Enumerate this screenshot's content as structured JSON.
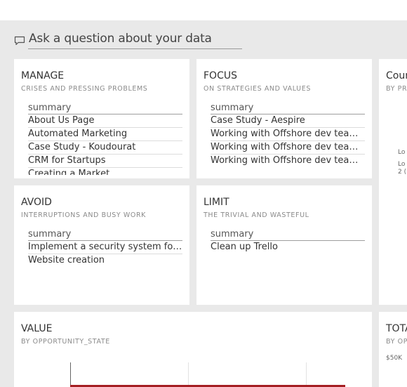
{
  "qa": {
    "placeholder": "Ask a question about your data"
  },
  "tiles": {
    "manage": {
      "title": "MANAGE",
      "subtitle": "CRISES AND PRESSING PROBLEMS",
      "header": "summary",
      "items": [
        "About Us Page",
        "Automated Marketing",
        "Case Study - Koudourat",
        "CRM for Startups"
      ],
      "cut_item": "Creating a Market"
    },
    "focus": {
      "title": "FOCUS",
      "subtitle": "ON STRATEGIES AND VALUES",
      "header": "summary",
      "items": [
        "Case Study - Aespire",
        "Working with Offshore dev teams ...",
        "Working with Offshore dev teams ...",
        "Working with Offshore dev teams ..."
      ]
    },
    "avoid": {
      "title": "AVOID",
      "subtitle": "INTERRUPTIONS AND BUSY WORK",
      "header": "summary",
      "items": [
        "Implement a security system for IR...",
        "Website creation"
      ]
    },
    "limit": {
      "title": "LIMIT",
      "subtitle": "THE TRIVIAL AND WASTEFUL",
      "header": "summary",
      "items": [
        "Clean up Trello"
      ]
    },
    "count": {
      "title": "Cour",
      "subtitle": "BY PR",
      "label1": "Lo",
      "label2": "Lo",
      "label3": "2 ("
    },
    "value": {
      "title": "VALUE",
      "subtitle": "BY OPPORTUNITY_STATE"
    },
    "total": {
      "title": "TOTA",
      "subtitle": "BY OP",
      "amount": "$50K"
    }
  },
  "chart_data": {
    "type": "bar",
    "title": "VALUE",
    "subtitle": "BY OPPORTUNITY_STATE",
    "series": [
      {
        "values": [
          1
        ]
      }
    ],
    "bar_color": "#a51e22",
    "grid": true
  }
}
